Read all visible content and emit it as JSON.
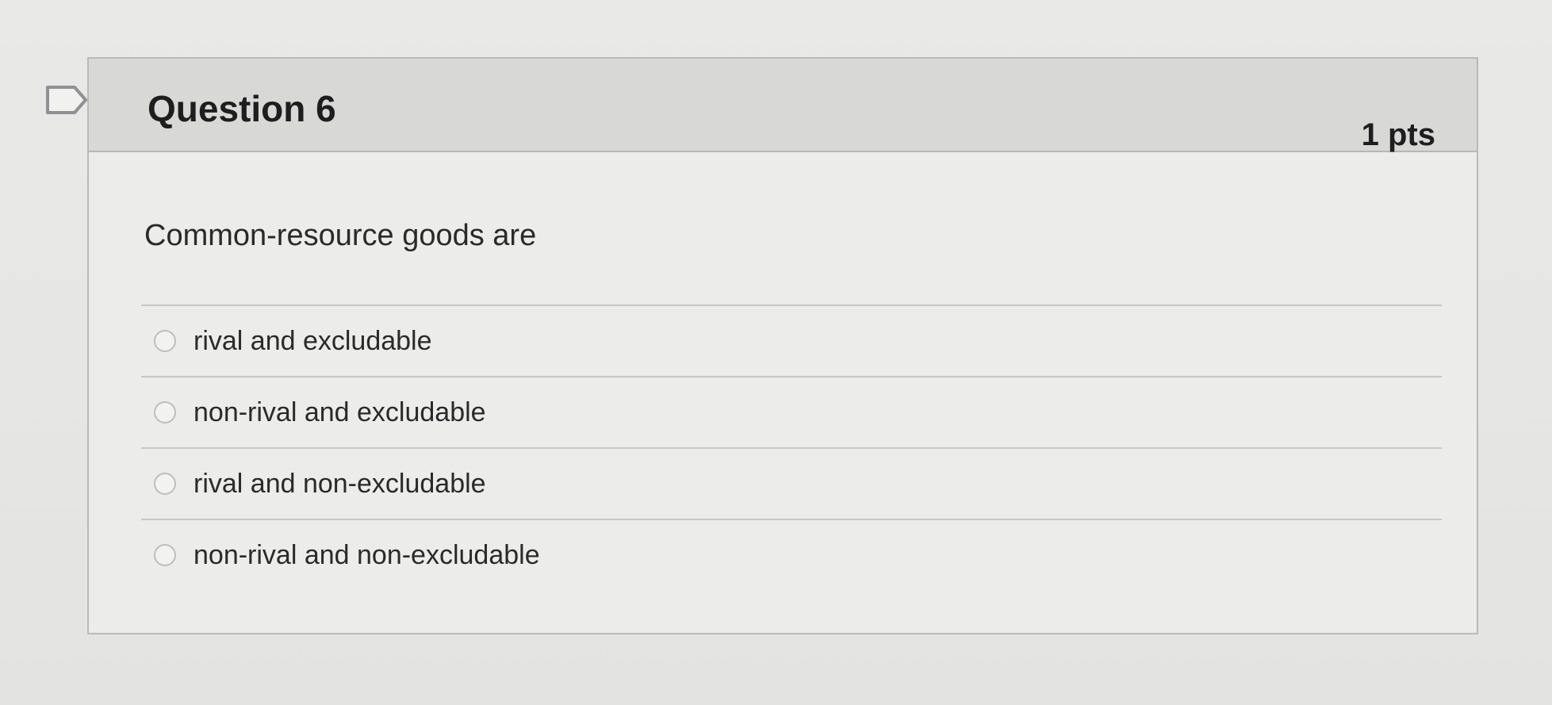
{
  "question": {
    "title": "Question 6",
    "points": "1 pts",
    "text": "Common-resource goods are",
    "flag_icon": "flag-icon",
    "answers": [
      {
        "label": "rival and excludable",
        "selected": false
      },
      {
        "label": "non-rival and excludable",
        "selected": false
      },
      {
        "label": "rival and non-excludable",
        "selected": false
      },
      {
        "label": "non-rival and non-excludable",
        "selected": false
      }
    ]
  }
}
